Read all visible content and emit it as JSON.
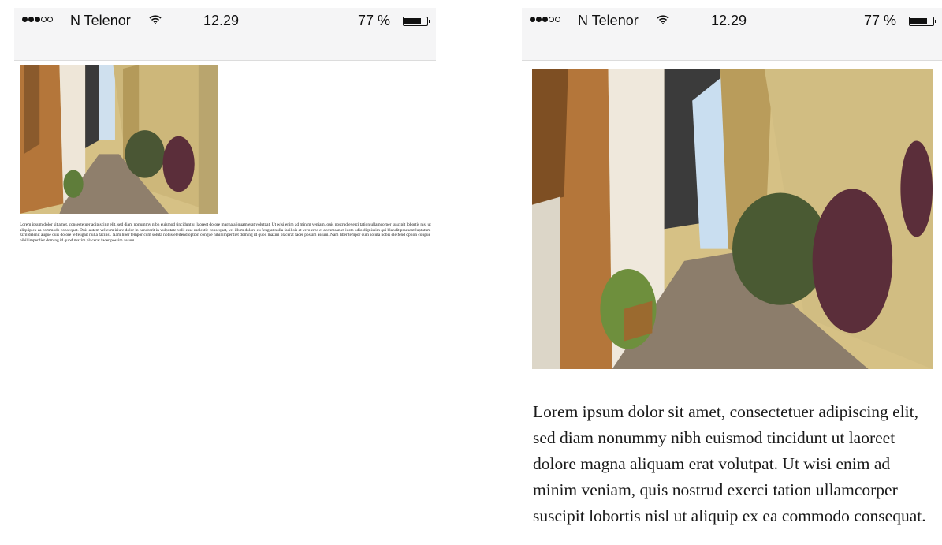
{
  "status_bar": {
    "carrier": "N Telenor",
    "time": "12.29",
    "battery_percent": "77 %",
    "signal_bars_filled": 3,
    "signal_bars_total": 5,
    "battery_level": 0.77
  },
  "left_screen": {
    "photo": "alley-photo",
    "paragraph": "Lorem ipsum dolor sit amet, consectetuer adipiscing elit, sed diam nonummy nibh euismod tincidunt ut laoreet dolore magna aliquam erat volutpat. Ut wisi enim ad minim veniam, quis nostrud exerci tation ullamcorper suscipit lobortis nisl ut aliquip ex ea commodo consequat. Duis autem vel eum iriure dolor in hendrerit in vulputate velit esse molestie consequat, vel illum dolore eu feugiat nulla facilisis at vero eros et accumsan et iusto odio dignissim qui blandit praesent luptatum zzril delenit augue duis dolore te feugait nulla facilisi. Nam liber tempor cum soluta nobis eleifend option congue nihil imperdiet doming id quod mazim placerat facer possim assum. Nam liber tempor cum soluta nobis eleifend option congue nihil imperdiet doming id quod mazim placerat facer possim assum."
  },
  "right_screen": {
    "photo": "alley-photo",
    "paragraph": "Lorem ipsum dolor sit amet, consectetuer adipiscing elit, sed diam nonummy nibh euismod tincidunt ut laoreet dolore magna aliquam erat volutpat. Ut wisi enim ad minim veniam, quis nostrud exerci tation ullamcorper suscipit lobortis nisl ut aliquip ex ea commodo consequat."
  }
}
